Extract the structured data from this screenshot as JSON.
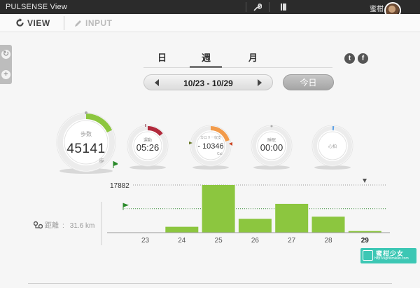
{
  "app": {
    "title": "PULSENSE View",
    "user_name": "蜜柑"
  },
  "toolbar": {
    "wrench_icon": "wrench-icon",
    "book_icon": "book-icon"
  },
  "modes": {
    "view": "VIEW",
    "input": "INPUT"
  },
  "period_tabs": {
    "day": "日",
    "week": "週",
    "month": "月",
    "active": "week"
  },
  "date_nav": {
    "range": "10/23 - 10/29",
    "today": "今日"
  },
  "social": {
    "twitter": "t",
    "facebook": "f"
  },
  "metrics": {
    "steps": {
      "label": "歩数",
      "value": "45141",
      "unit": "歩",
      "progress": 0.18,
      "color": "#8cc63f"
    },
    "activity": {
      "label": "運動",
      "value": "05:26",
      "progress": 0.14,
      "color": "#b12a3c"
    },
    "calories": {
      "label": "カロリー収支",
      "value": "- 10346",
      "unit": "Cal",
      "color": "#f29b4b"
    },
    "sleep": {
      "label": "睡眠",
      "value": "00:00"
    },
    "heart": {
      "label": "心拍",
      "color": "#5aa0e6"
    }
  },
  "distance": {
    "label": "距離",
    "value": "31.6 km"
  },
  "chart_data": {
    "type": "bar",
    "categories": [
      "23",
      "24",
      "25",
      "26",
      "27",
      "28",
      "29"
    ],
    "values": [
      0,
      2200,
      17882,
      5200,
      10800,
      6000,
      600
    ],
    "max_label": "17882",
    "goal": 9000,
    "ylim": [
      0,
      17882
    ],
    "bar_color": "#8cc63f"
  },
  "watermark": {
    "title": "蜜柑少女",
    "url": "http://ugirlsmikan.com"
  }
}
